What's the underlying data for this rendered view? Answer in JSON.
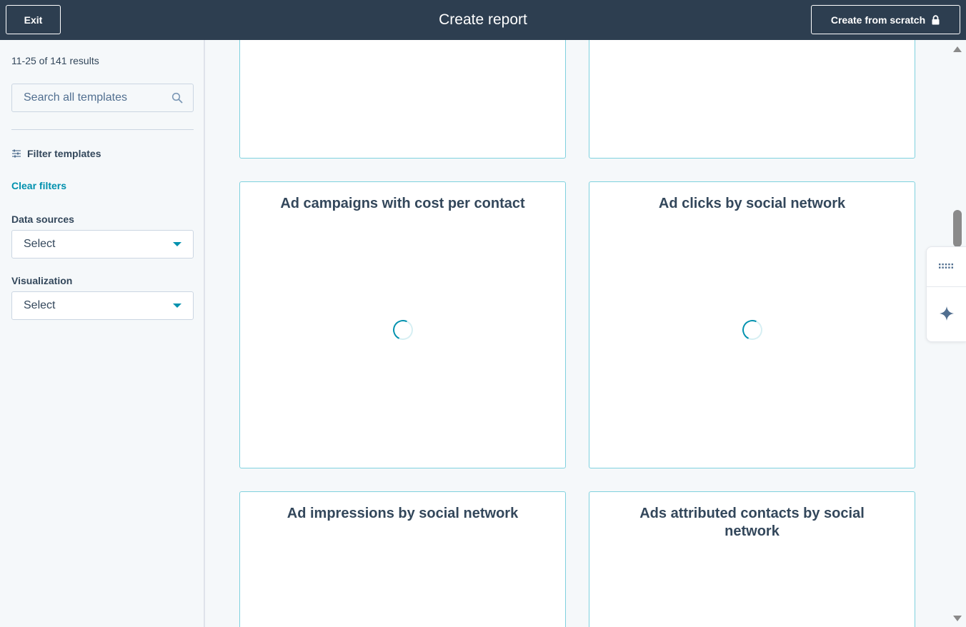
{
  "header": {
    "exit_label": "Exit",
    "title": "Create report",
    "create_scratch_label": "Create from scratch",
    "lock_icon": "lock-icon"
  },
  "sidebar": {
    "results_count": "11-25 of 141 results",
    "search": {
      "placeholder": "Search all templates",
      "value": "",
      "icon": "search-icon"
    },
    "filter_heading": "Filter templates",
    "filter_icon": "sliders-icon",
    "clear_filters_label": "Clear filters",
    "data_sources": {
      "label": "Data sources",
      "selected": "Select"
    },
    "visualization": {
      "label": "Visualization",
      "selected": "Select"
    }
  },
  "cards": [
    {
      "title": ""
    },
    {
      "title": ""
    },
    {
      "title": "Ad campaigns with cost per contact",
      "loading": true
    },
    {
      "title": "Ad clicks by social network",
      "loading": true
    },
    {
      "title": "Ad impressions by social network"
    },
    {
      "title": "Ads attributed contacts by social network"
    }
  ],
  "side_widget": {
    "top_icon": "grid-dots-icon",
    "bottom_icon": "sparkle-icon"
  },
  "colors": {
    "header_bg": "#2d3e50",
    "accent": "#0091ae",
    "card_border": "#7fd1de",
    "text": "#33475b",
    "widget_sparkle": "#516f90"
  }
}
